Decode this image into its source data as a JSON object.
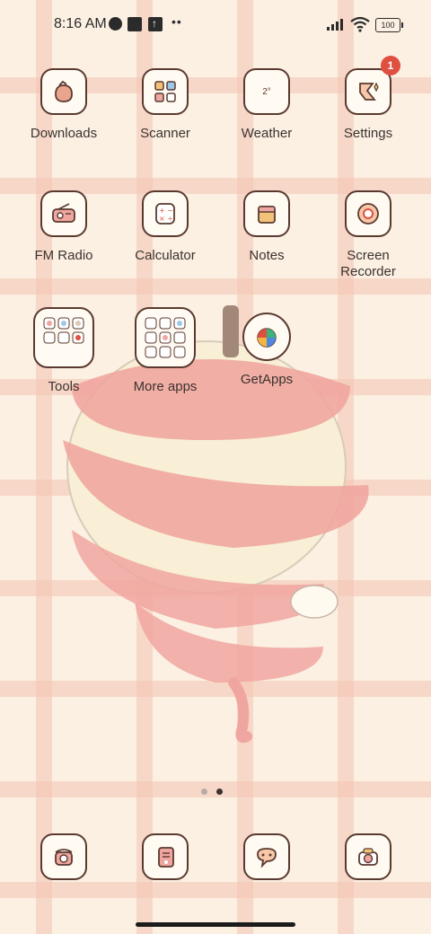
{
  "status": {
    "time": "8:16 AM",
    "battery": "100"
  },
  "apps": [
    {
      "label": "Downloads",
      "icon": "downloads-icon"
    },
    {
      "label": "Scanner",
      "icon": "scanner-icon"
    },
    {
      "label": "Weather",
      "icon": "weather-icon",
      "tile_text": "2°"
    },
    {
      "label": "Settings",
      "icon": "settings-icon",
      "badge": "1"
    },
    {
      "label": "FM Radio",
      "icon": "radio-icon"
    },
    {
      "label": "Calculator",
      "icon": "calculator-icon"
    },
    {
      "label": "Notes",
      "icon": "notes-icon"
    },
    {
      "label": "Screen Recorder",
      "icon": "screen-recorder-icon"
    },
    {
      "label": "Tools",
      "icon": "folder-icon"
    },
    {
      "label": "More apps",
      "icon": "folder-icon"
    },
    {
      "label": "GetApps",
      "icon": "getapps-icon"
    }
  ],
  "dock": [
    {
      "icon": "phone-icon"
    },
    {
      "icon": "contacts-icon"
    },
    {
      "icon": "messages-icon"
    },
    {
      "icon": "camera-icon"
    }
  ],
  "pager": {
    "pages": 2,
    "active": 2
  },
  "colors": {
    "outline": "#5a3a30",
    "badge": "#e05040",
    "peel": "#f0a6a0"
  }
}
